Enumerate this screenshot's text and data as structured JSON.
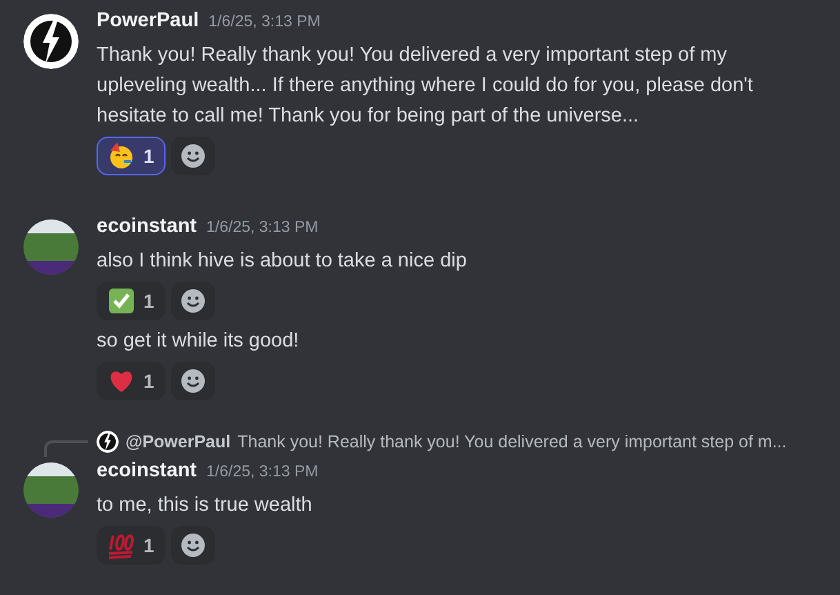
{
  "messages": [
    {
      "kind": "full",
      "avatar": {
        "kind": "bolt"
      },
      "author": "PowerPaul",
      "time": "1/6/25, 3:13 PM",
      "text": "Thank you! Really thank you! You delivered a very important step of my upleveling wealth... If there anything where I could do for you, please don't hesitate to call me! Thank you for being part of the universe...",
      "reactions": [
        {
          "kind": "party",
          "count": "1",
          "selected": true
        }
      ]
    },
    {
      "kind": "full",
      "avatar": {
        "kind": "photo"
      },
      "author": "ecoinstant",
      "time": "1/6/25, 3:13 PM",
      "text": "also I think hive is about to take a nice dip",
      "reactions": [
        {
          "kind": "check",
          "count": "1",
          "selected": false
        }
      ]
    },
    {
      "kind": "continuation",
      "text": "so get it while its good!",
      "reactions": [
        {
          "kind": "heart",
          "count": "1",
          "selected": false
        }
      ]
    },
    {
      "kind": "full",
      "avatar": {
        "kind": "photo"
      },
      "author": "ecoinstant",
      "time": "1/6/25, 3:13 PM",
      "reply": {
        "avatar": {
          "kind": "bolt"
        },
        "author": "@PowerPaul",
        "text": "Thank you! Really thank you! You delivered a very important step of m..."
      },
      "text": "to me, this is true wealth",
      "reactions": [
        {
          "kind": "hundred",
          "count": "1",
          "selected": false
        }
      ]
    }
  ]
}
